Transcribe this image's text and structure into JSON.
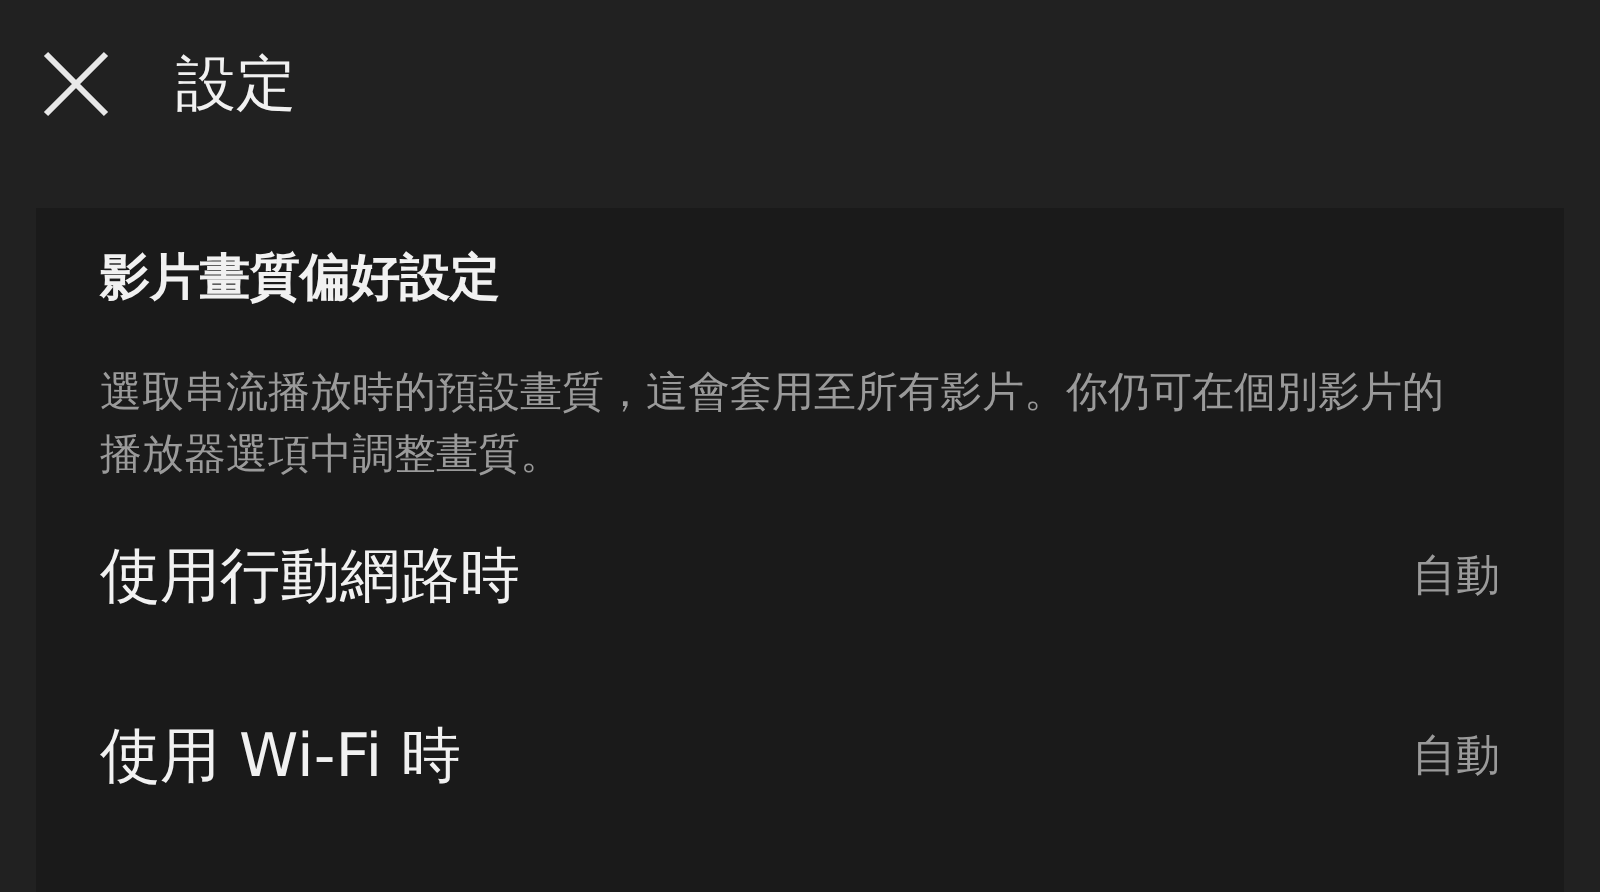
{
  "header": {
    "title": "設定"
  },
  "section": {
    "title": "影片畫質偏好設定",
    "description": "選取串流播放時的預設畫質，這會套用至所有影片。你仍可在個別影片的播放器選項中調整畫質。",
    "rows": [
      {
        "label": "使用行動網路時",
        "value": "自動"
      },
      {
        "label": "使用 Wi-Fi 時",
        "value": "自動"
      }
    ]
  }
}
